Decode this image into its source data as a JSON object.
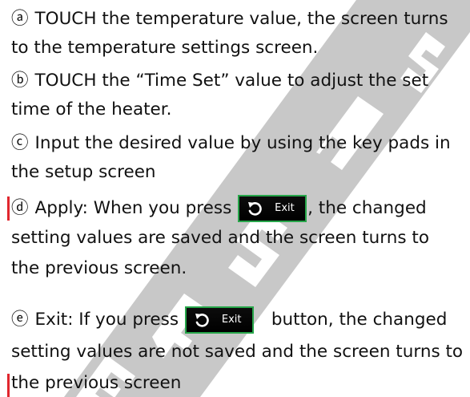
{
  "instructions": [
    {
      "marker": "ⓐ",
      "lines": [
        "TOUCH the temperature value, the screen turns",
        "to the temperature settings screen."
      ]
    },
    {
      "marker": "ⓑ",
      "lines": [
        "TOUCH the “Time Set” value to adjust the set",
        "time of the heater."
      ]
    },
    {
      "marker": "ⓒ",
      "lines": [
        "Input the desired value by using the key pads in",
        "the setup screen"
      ]
    },
    {
      "marker": "ⓓ",
      "line1_before": "Apply: When you press",
      "line1_after": ", the changed",
      "lines": [
        "setting values are saved and the screen turns to",
        "the previous screen."
      ]
    },
    {
      "marker": "ⓔ",
      "line1_before": "Exit: If you press",
      "line1_after": "button, the changed",
      "lines": [
        "setting values are not saved and the screen turns to",
        "the previous screen"
      ]
    }
  ],
  "exit_button": {
    "label": "Exit",
    "icon": "undo-arrow-icon",
    "background": "#000000",
    "border_color": "#27a64a"
  },
  "watermark": {
    "text": "ER SAS",
    "color": "#c8c8c8"
  },
  "colors": {
    "text": "#111111",
    "revision_bar": "#e0262e"
  }
}
